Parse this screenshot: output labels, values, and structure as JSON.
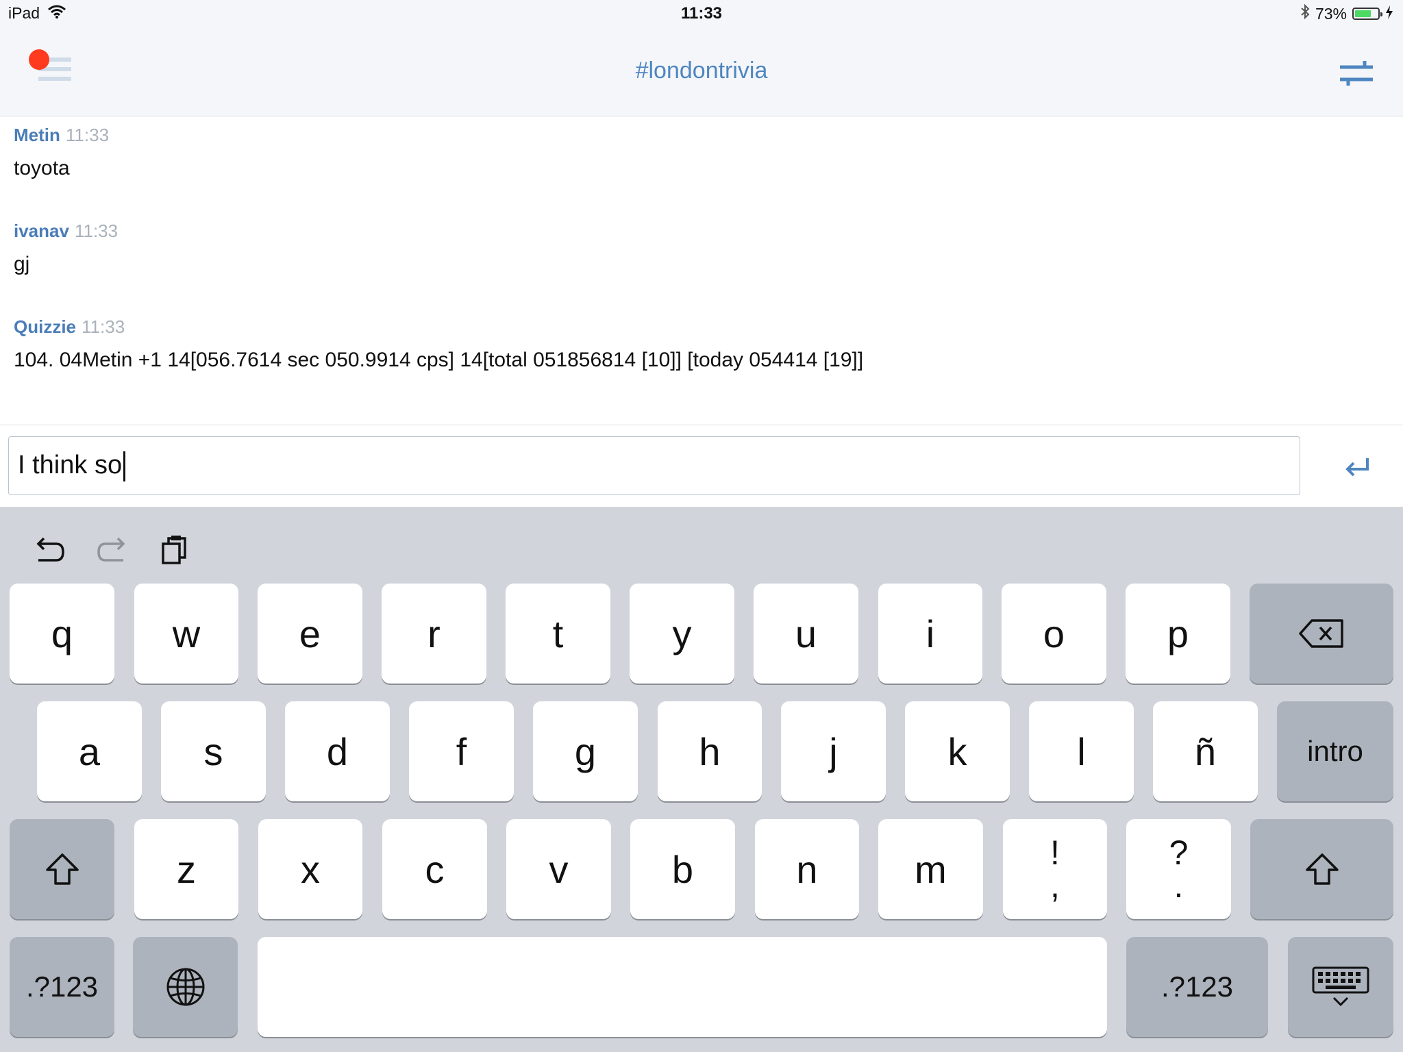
{
  "status_bar": {
    "device": "iPad",
    "time": "11:33",
    "battery_percent": "73%",
    "battery_level": 0.73
  },
  "nav": {
    "title": "#londontrivia",
    "notification_color": "#ff3b1f",
    "accent_color": "#4f86c0"
  },
  "messages": [
    {
      "author": "Metin",
      "time": "11:33",
      "text": "toyota"
    },
    {
      "author": "ivanav",
      "time": "11:33",
      "text": "gj"
    },
    {
      "author": "Quizzie",
      "time": "11:33",
      "text": "104. 04Metin +1 14[056.7614 sec 050.9914 cps] 14[total 051856814 [10]] [today 054414 [19]]"
    }
  ],
  "input": {
    "value": "I think so"
  },
  "keyboard": {
    "row1": [
      "q",
      "w",
      "e",
      "r",
      "t",
      "y",
      "u",
      "i",
      "o",
      "p"
    ],
    "row2": [
      "a",
      "s",
      "d",
      "f",
      "g",
      "h",
      "j",
      "k",
      "l",
      "ñ"
    ],
    "row3": [
      "z",
      "x",
      "c",
      "v",
      "b",
      "n",
      "m"
    ],
    "punct1": {
      "top": "!",
      "bottom": ","
    },
    "punct2": {
      "top": "?",
      "bottom": "."
    },
    "return_label": "intro",
    "numbers_label": ".?123",
    "icons": [
      "undo-icon",
      "redo-icon",
      "paste-icon",
      "backspace-icon",
      "shift-icon",
      "globe-icon",
      "keyboard-dismiss-icon"
    ]
  }
}
